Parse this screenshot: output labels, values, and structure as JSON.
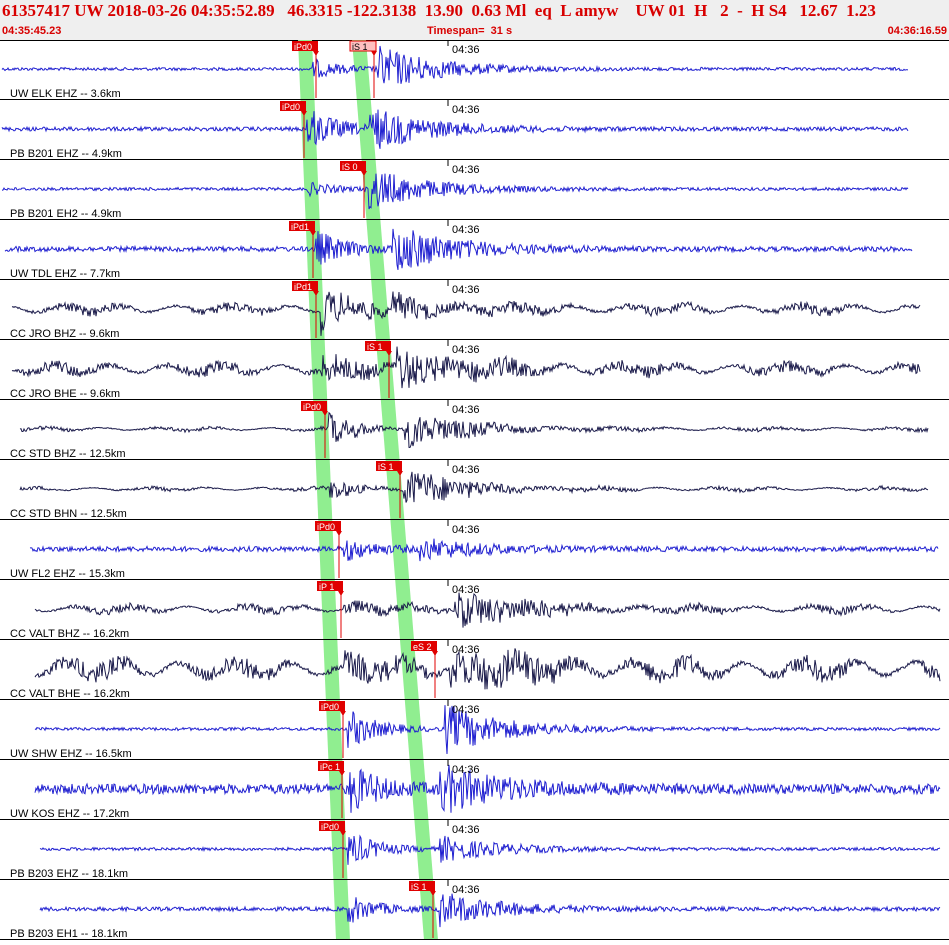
{
  "header": {
    "event_line": "61357417 UW 2018-03-26 04:35:52.89   46.3315 -122.3138  13.90  0.63 Ml  eq  L amyw    UW 01  H   2  -  H S4   12.67  1.23",
    "start_time": "04:35:45.23",
    "timespan": "Timespan=  31 s",
    "end_time": "04:36:16.59"
  },
  "colors": {
    "header_text": "#d80000",
    "blue_trace": "#1f1fd0",
    "dark_trace": "#1a1a4a",
    "pick_marker": "#e00000",
    "predicted_band": "#90ee90",
    "panel_border": "#000000"
  },
  "traces": [
    {
      "label": "UW ELK EHZ -- 3.6km",
      "minute_label": "04:36",
      "color": "blue",
      "picks": [
        {
          "label": "iPd0",
          "style": "dark"
        },
        {
          "label": "iS 1",
          "style": "light"
        }
      ]
    },
    {
      "label": "PB B201 EHZ -- 4.9km",
      "minute_label": "04:36",
      "color": "blue",
      "picks": [
        {
          "label": "iPd0",
          "style": "dark"
        }
      ]
    },
    {
      "label": "PB B201 EH2 -- 4.9km",
      "minute_label": "04:36",
      "color": "blue",
      "picks": [
        {
          "label": "iS 0",
          "style": "dark"
        }
      ]
    },
    {
      "label": "UW TDL EHZ -- 7.7km",
      "minute_label": "04:36",
      "color": "blue",
      "picks": [
        {
          "label": "iPd1",
          "style": "dark"
        }
      ]
    },
    {
      "label": "CC JRO BHZ -- 9.6km",
      "minute_label": "04:36",
      "color": "dark",
      "picks": [
        {
          "label": "iPd1",
          "style": "dark"
        }
      ]
    },
    {
      "label": "CC JRO BHE -- 9.6km",
      "minute_label": "04:36",
      "color": "dark",
      "picks": [
        {
          "label": "iS 1",
          "style": "dark"
        }
      ]
    },
    {
      "label": "CC STD BHZ -- 12.5km",
      "minute_label": "04:36",
      "color": "dark",
      "picks": [
        {
          "label": "iPd0",
          "style": "dark"
        }
      ]
    },
    {
      "label": "CC STD BHN -- 12.5km",
      "minute_label": "04:36",
      "color": "dark",
      "picks": [
        {
          "label": "iS 1",
          "style": "dark"
        }
      ]
    },
    {
      "label": "UW FL2 EHZ -- 15.3km",
      "minute_label": "04:36",
      "color": "blue",
      "picks": [
        {
          "label": "iPd0",
          "style": "dark"
        }
      ]
    },
    {
      "label": "CC VALT BHZ -- 16.2km",
      "minute_label": "04:36",
      "color": "dark",
      "picks": [
        {
          "label": "iP 1",
          "style": "dark"
        }
      ]
    },
    {
      "label": "CC VALT BHE -- 16.2km",
      "minute_label": "04:36",
      "color": "dark",
      "picks": [
        {
          "label": "eS 2",
          "style": "dark"
        }
      ]
    },
    {
      "label": "UW SHW EHZ -- 16.5km",
      "minute_label": "04:36",
      "color": "blue",
      "picks": [
        {
          "label": "iPd0",
          "style": "dark"
        }
      ]
    },
    {
      "label": "UW KOS EHZ -- 17.2km",
      "minute_label": "04:36",
      "color": "blue",
      "picks": [
        {
          "label": "iPc 1",
          "style": "dark"
        }
      ]
    },
    {
      "label": "PB B203 EHZ -- 18.1km",
      "minute_label": "04:36",
      "color": "blue",
      "picks": [
        {
          "label": "iPd0",
          "style": "dark"
        }
      ]
    },
    {
      "label": "PB B203 EH1 -- 18.1km",
      "minute_label": "04:36",
      "color": "blue",
      "picks": [
        {
          "label": "iS 1",
          "style": "dark"
        }
      ]
    }
  ]
}
